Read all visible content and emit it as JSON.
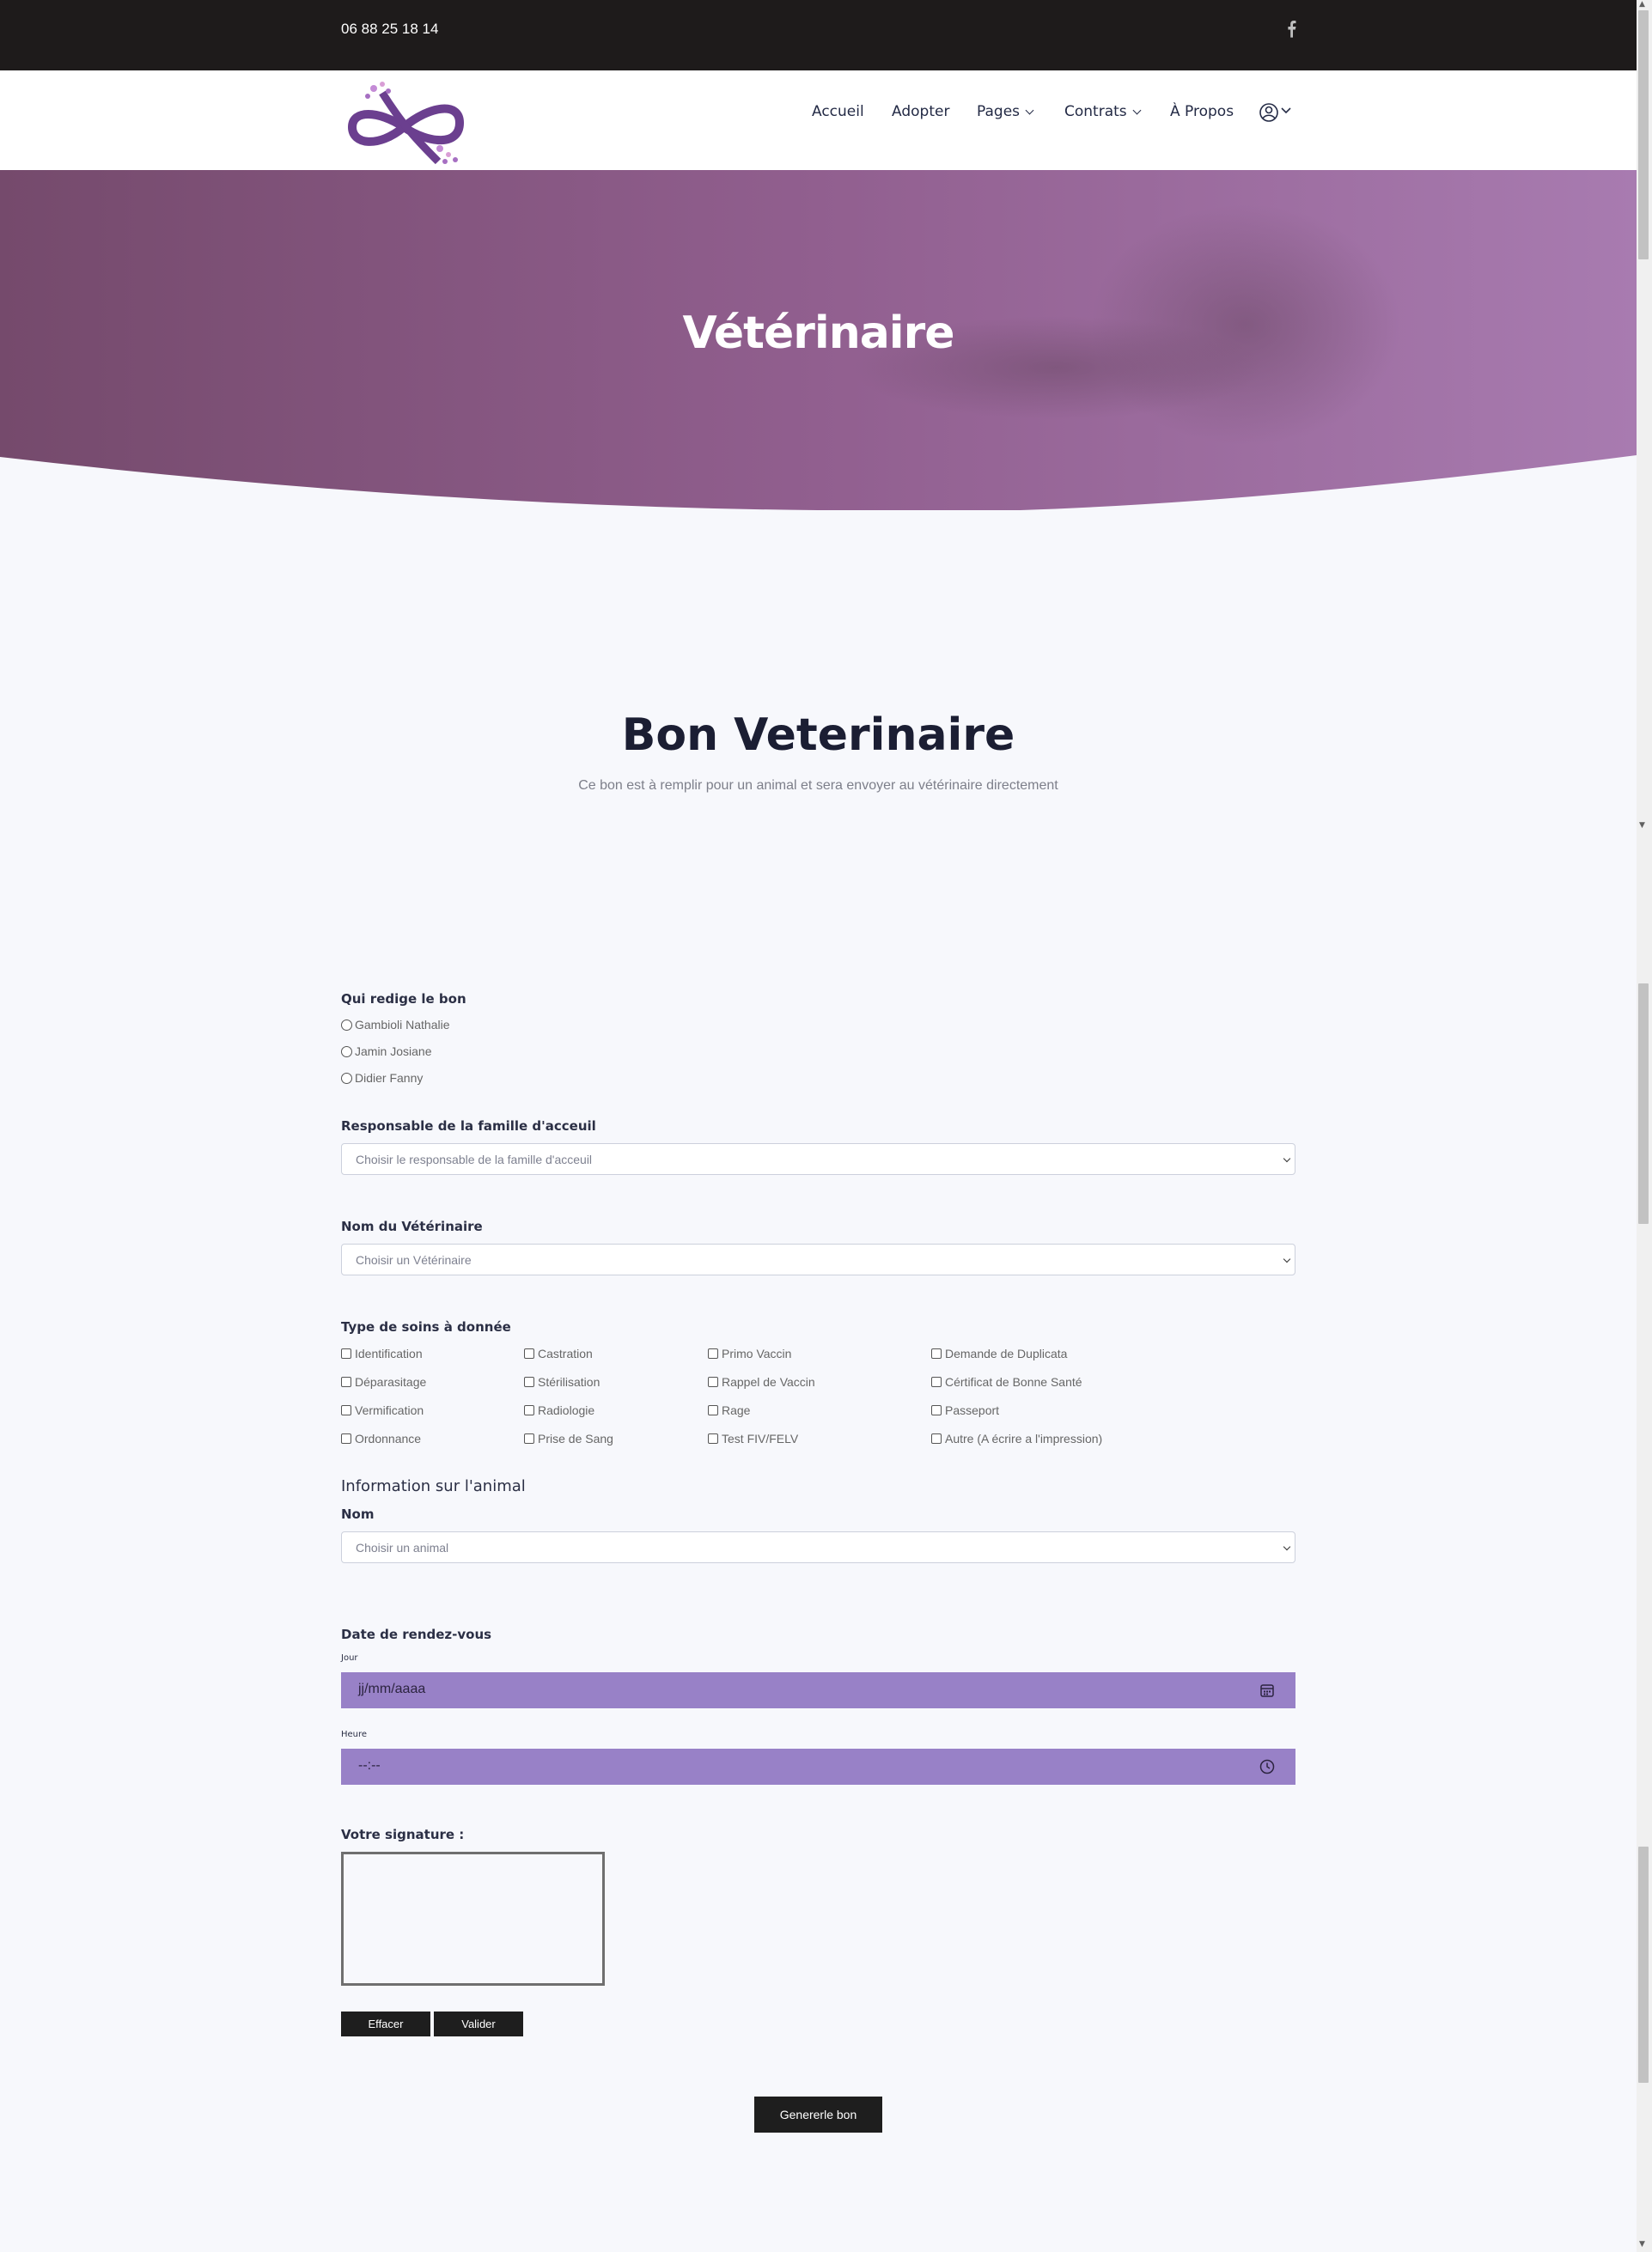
{
  "topbar": {
    "phone": "06 88 25 18 14",
    "social_icon": "facebook-icon"
  },
  "header": {
    "logo": "infinity-paws-logo",
    "nav": [
      {
        "label": "Accueil",
        "dropdown": false
      },
      {
        "label": "Adopter",
        "dropdown": false
      },
      {
        "label": "Pages",
        "dropdown": true
      },
      {
        "label": "Contrats",
        "dropdown": true
      },
      {
        "label": "À Propos",
        "dropdown": false
      }
    ],
    "user_icon": "user-circle-icon"
  },
  "hero": {
    "title": "Vétérinaire"
  },
  "section": {
    "title": "Bon Veterinaire",
    "subtitle": "Ce bon est à remplir pour un animal et sera envoyer au vétérinaire directement"
  },
  "form": {
    "author": {
      "label": "Qui redige le bon",
      "options": [
        "Gambioli Nathalie",
        "Jamin Josiane",
        "Didier Fanny"
      ]
    },
    "foster": {
      "label": "Responsable de la famille d'acceuil",
      "placeholder": "Choisir le responsable de la famille d'acceuil"
    },
    "vet": {
      "label": "Nom du Vétérinaire",
      "placeholder": "Choisir un Vétérinaire"
    },
    "care": {
      "label": "Type de soins à donnée",
      "columns": [
        [
          "Identification",
          "Déparasitage",
          "Vermification",
          "Ordonnance"
        ],
        [
          "Castration",
          "Stérilisation",
          "Radiologie",
          "Prise de Sang"
        ],
        [
          "Primo Vaccin",
          "Rappel de Vaccin",
          "Rage",
          "Test FIV/FELV"
        ],
        [
          "Demande de Duplicata",
          "Cértificat de Bonne Santé",
          "Passeport",
          "Autre (A écrire a l'impression)"
        ]
      ]
    },
    "animal": {
      "heading": "Information sur l'animal",
      "label": "Nom",
      "placeholder": "Choisir un animal"
    },
    "appointment": {
      "label": "Date de rendez-vous",
      "day_label": "Jour",
      "day_placeholder": "jj/mm/aaaa",
      "time_label": "Heure",
      "time_placeholder": "--:--"
    },
    "signature": {
      "label": "Votre signature :"
    },
    "buttons": {
      "clear": "Effacer",
      "validate": "Valider",
      "generate": "Genererle bon"
    }
  },
  "colors": {
    "topbar": "#1e1b1b",
    "hero_start": "#7a4f72",
    "hero_end": "#a87bb0",
    "input_fill": "#9881c7",
    "button": "#1e1e1e"
  }
}
